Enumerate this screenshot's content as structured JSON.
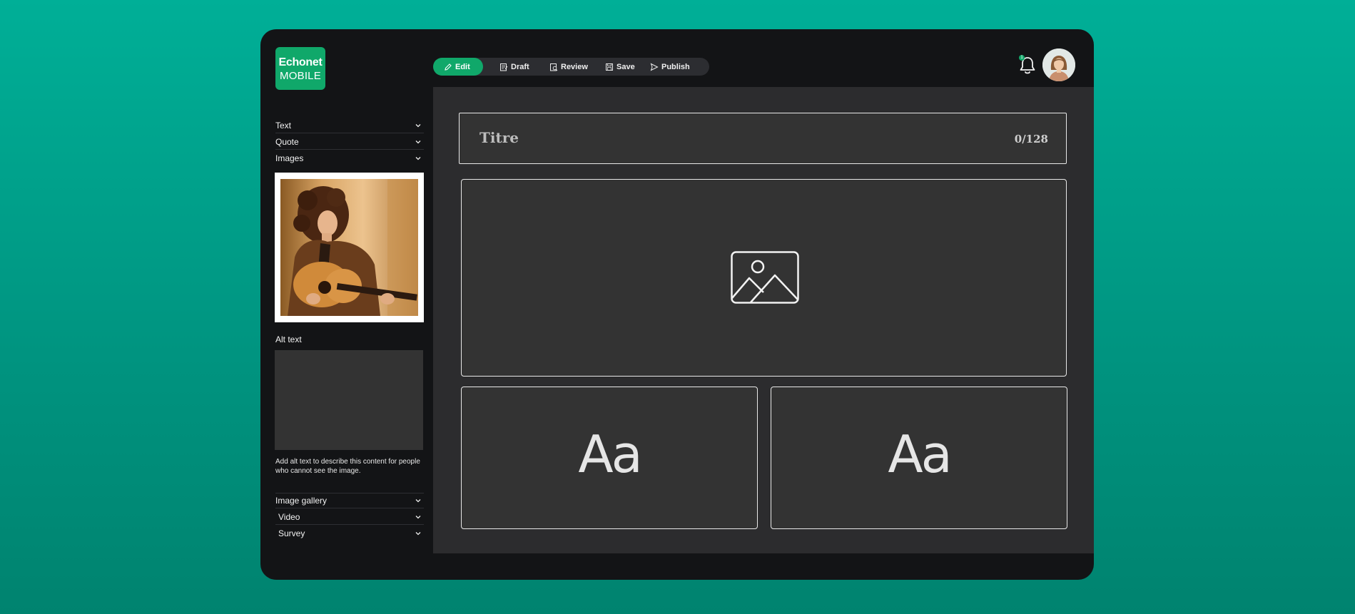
{
  "brand": {
    "line1": "Echonet",
    "line2": "MOBILE"
  },
  "toolbar": {
    "edit": "Edit",
    "draft": "Draft",
    "review": "Review",
    "save": "Save",
    "publish": "Publish"
  },
  "notifications": {
    "count": "1"
  },
  "sidebar": {
    "items_top": [
      {
        "label": "Text"
      },
      {
        "label": "Quote"
      },
      {
        "label": "Images"
      }
    ],
    "alt_text": {
      "label": "Alt text",
      "value": "",
      "help": "Add alt text to describe this content for people who cannot see the image."
    },
    "items_bottom": [
      {
        "label": "Image gallery"
      },
      {
        "label": "Video"
      },
      {
        "label": "Survey"
      }
    ]
  },
  "editor": {
    "title_placeholder": "Titre",
    "char_count": "0/128",
    "text_block_left": "Aa",
    "text_block_right": "Aa"
  },
  "colors": {
    "accent": "#10a86a",
    "background": "#00a690",
    "panel": "#131416",
    "canvas": "#2c2c2e"
  }
}
